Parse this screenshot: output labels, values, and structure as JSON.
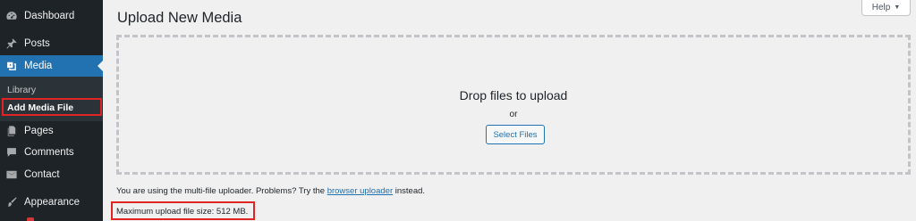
{
  "sidebar": {
    "items": [
      {
        "label": "Dashboard",
        "icon": "dashboard-icon"
      },
      {
        "label": "Posts",
        "icon": "pin-icon"
      },
      {
        "label": "Media",
        "icon": "media-icon",
        "active": true
      },
      {
        "label": "Pages",
        "icon": "pages-icon"
      },
      {
        "label": "Comments",
        "icon": "comment-icon"
      },
      {
        "label": "Contact",
        "icon": "mail-icon"
      },
      {
        "label": "Appearance",
        "icon": "brush-icon"
      }
    ],
    "submenu": [
      {
        "label": "Library"
      },
      {
        "label": "Add Media File",
        "current": true
      }
    ]
  },
  "header": {
    "title": "Upload New Media",
    "help_label": "Help",
    "help_caret": "▼"
  },
  "dropzone": {
    "title": "Drop files to upload",
    "or_text": "or",
    "select_button": "Select Files"
  },
  "uploader_note": {
    "prefix": "You are using the multi-file uploader. Problems? Try the",
    "link": "browser uploader",
    "suffix": "instead."
  },
  "max_upload": "Maximum upload file size: 512 MB.",
  "colors": {
    "sidebar_bg": "#1d2327",
    "active_bg": "#2271b1",
    "highlight_border": "#e02424",
    "link": "#2271b1"
  }
}
